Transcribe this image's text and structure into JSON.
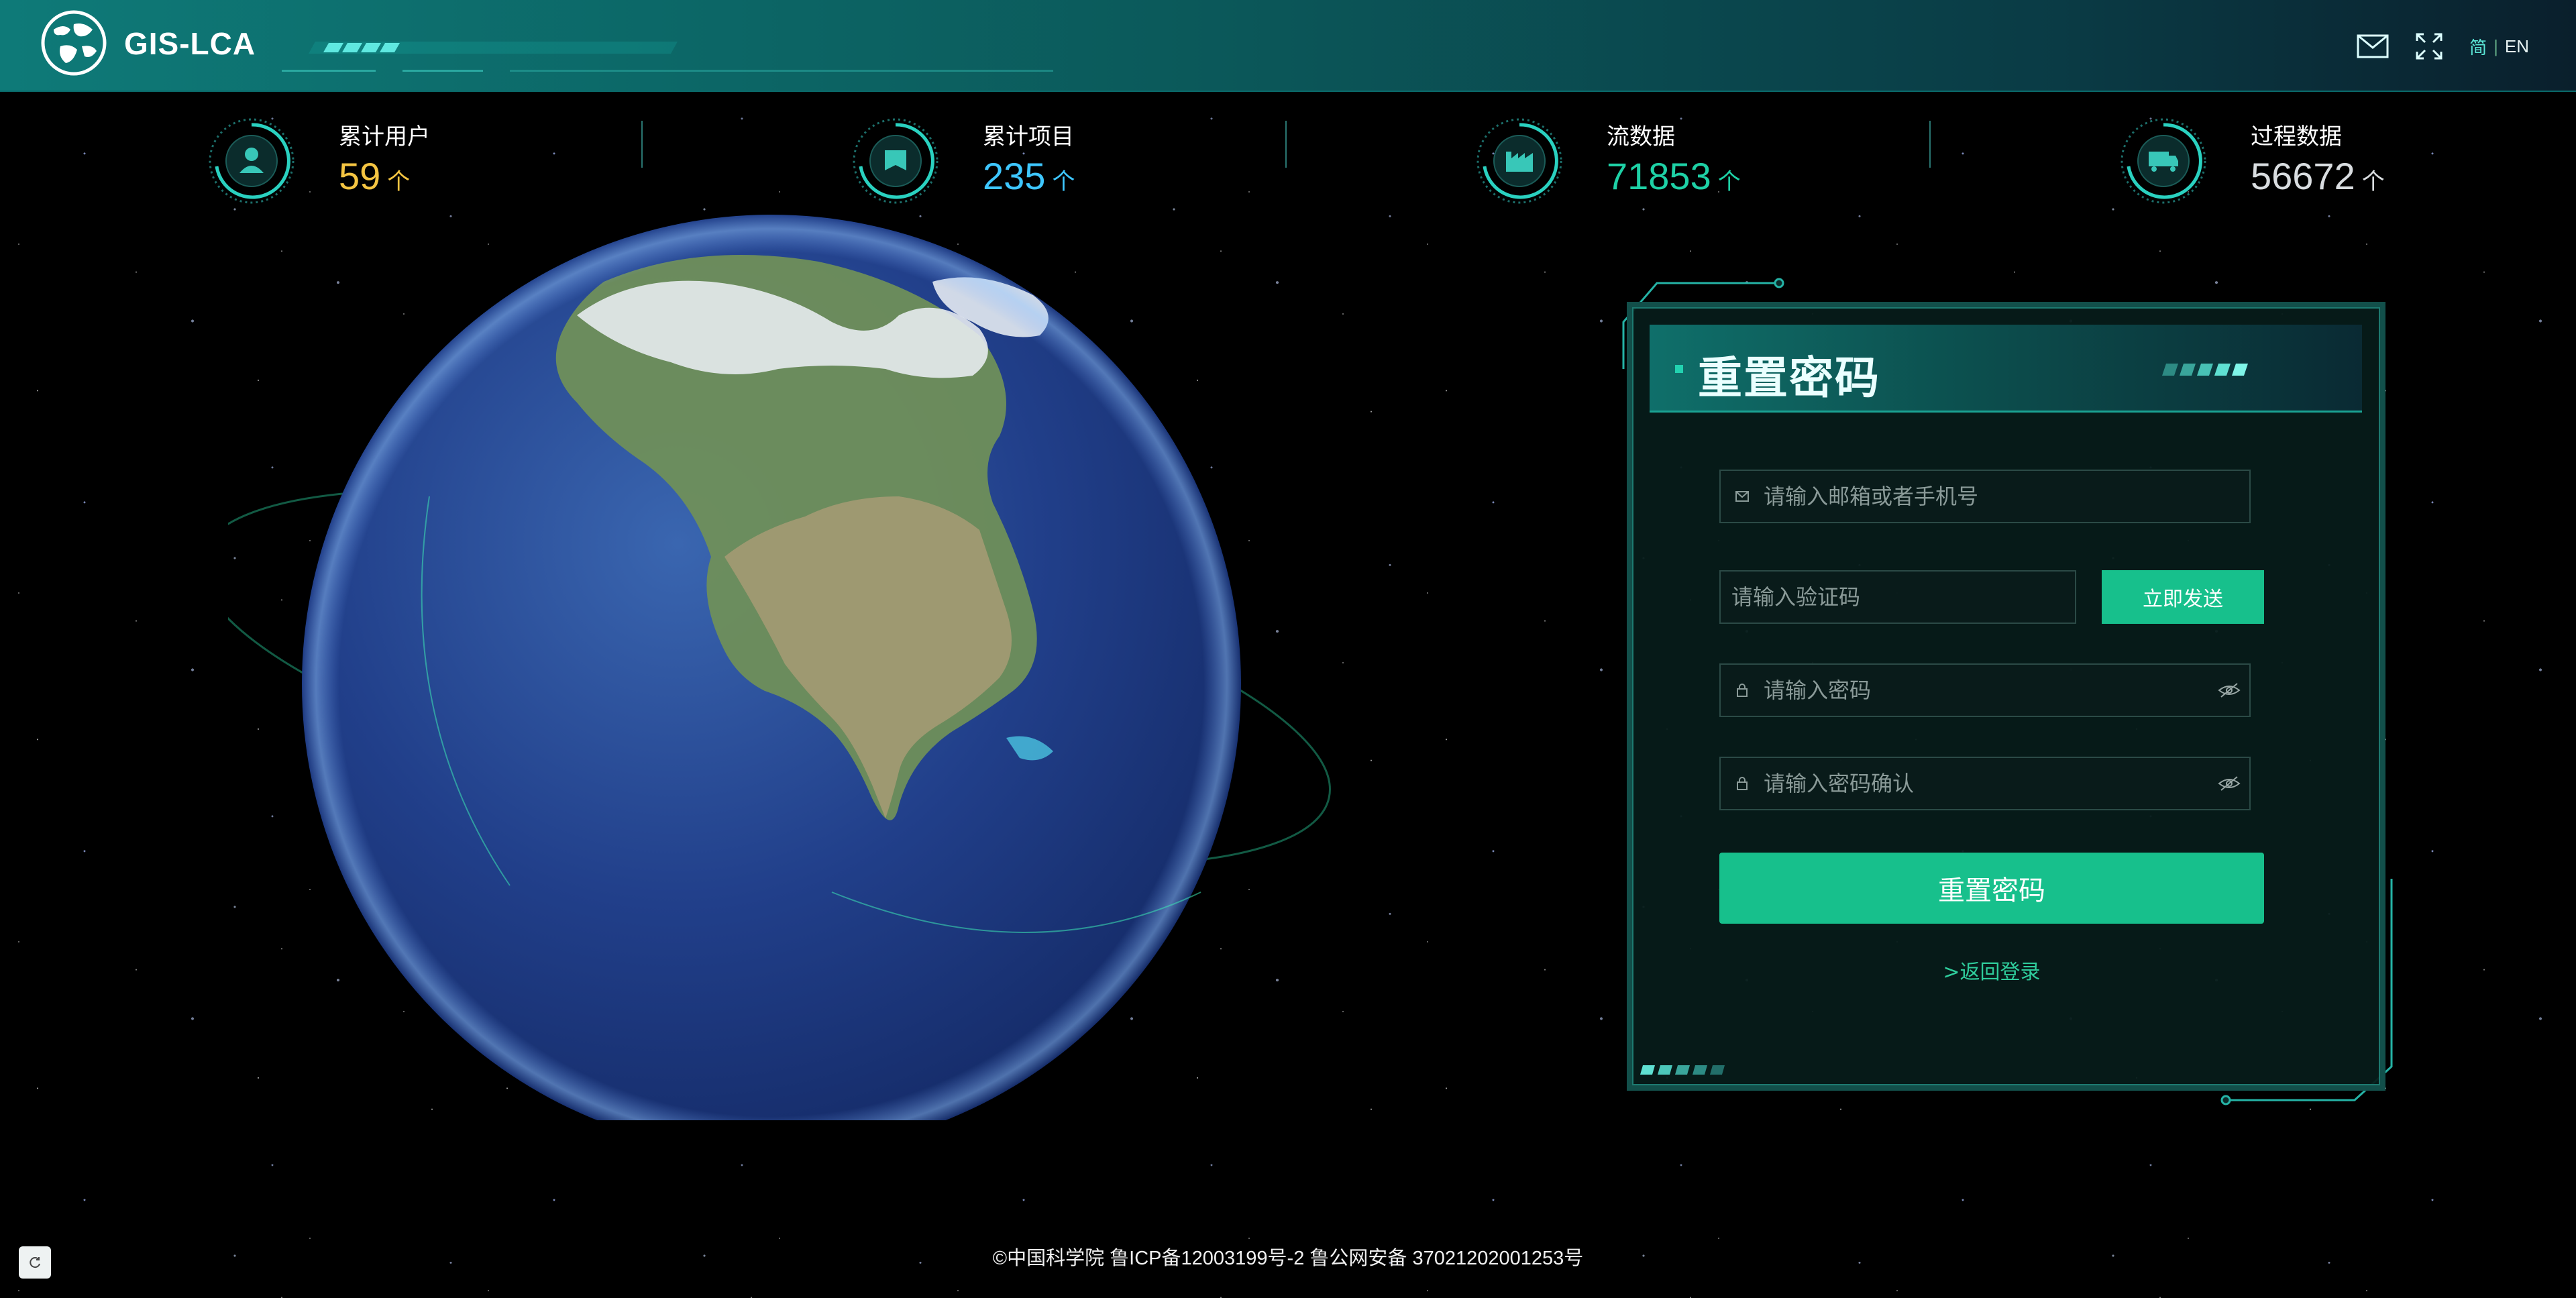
{
  "header": {
    "app_title": "GIS-LCA",
    "lang_active": "简",
    "lang_separator": "|",
    "lang_other": "EN",
    "icons": [
      "mail-icon",
      "fullscreen-icon"
    ]
  },
  "stats": [
    {
      "label": "累计用户",
      "value": "59",
      "unit": "个",
      "color": "#f5c542",
      "icon": "user-icon"
    },
    {
      "label": "累计项目",
      "value": "235",
      "unit": "个",
      "color": "#3ec7ff",
      "icon": "project-icon"
    },
    {
      "label": "流数据",
      "value": "71853",
      "unit": "个",
      "color": "#1ed1a6",
      "icon": "factory-icon"
    },
    {
      "label": "过程数据",
      "value": "56672",
      "unit": "个",
      "color": "#d9dde0",
      "icon": "truck-icon"
    }
  ],
  "reset_form": {
    "title": "重置密码",
    "account_placeholder": "请输入邮箱或者手机号",
    "code_placeholder": "请输入验证码",
    "send_button": "立即发送",
    "password_placeholder": "请输入密码",
    "confirm_placeholder": "请输入密码确认",
    "submit_button": "重置密码",
    "back_link": ">返回登录"
  },
  "footer": {
    "text": "©中国科学院 鲁ICP备12003199号-2 鲁公网安备 37021202001253号"
  },
  "colors": {
    "accent": "#17c08c",
    "header": "#0e7a78",
    "panel_border": "#124f4a"
  }
}
